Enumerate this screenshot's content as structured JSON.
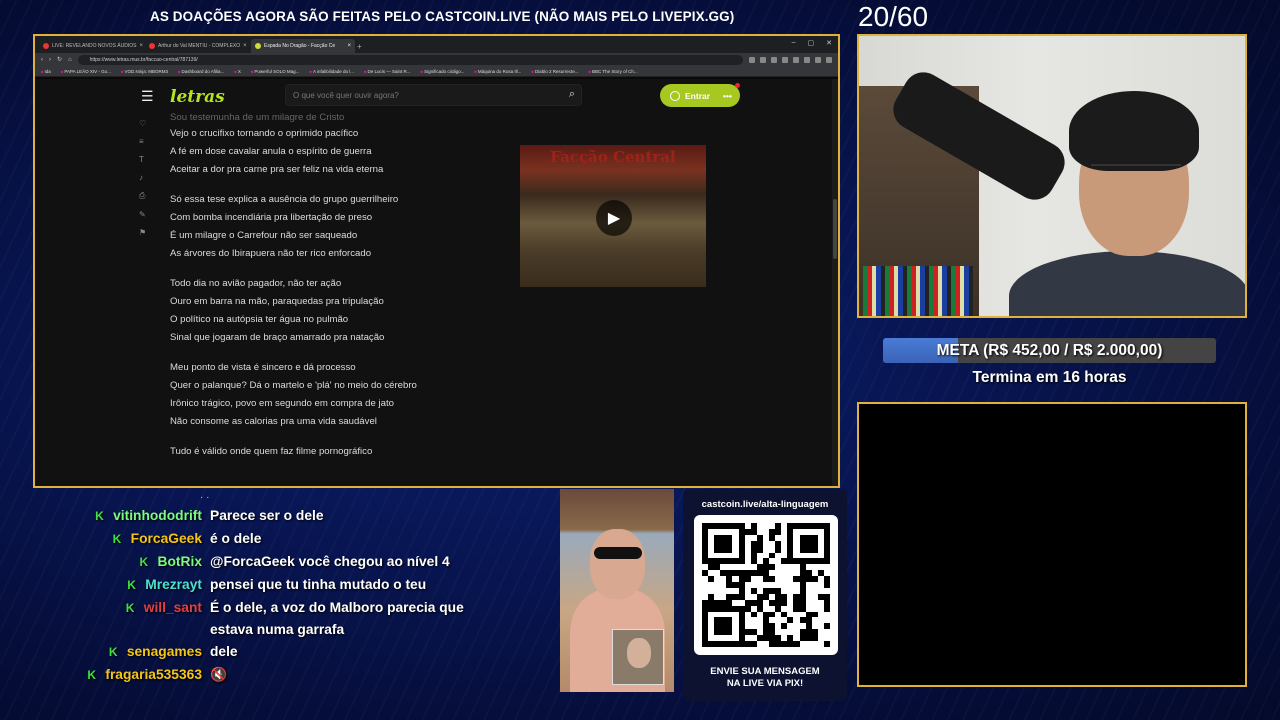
{
  "banner": "AS DOAÇÕES AGORA SÃO FEITAS PELO CASTCOIN.LIVE (NÃO MAIS PELO LIVEPIX.GG)",
  "counter": "20/60",
  "browser": {
    "tabs": [
      {
        "label": "LIVE: REVELANDO NOVOS ÁUDIOS"
      },
      {
        "label": "Arthur do Val MENTIU - COMPLEXO"
      },
      {
        "label": "Espada No Dragão - Facção Ce",
        "active": true
      }
    ],
    "url": "https://www.letras.mus.br/faccao-central/787139/",
    "bookmarks": [
      "Ida",
      "PAPA LEÃO XIV - Go...",
      "VOD.Ninja: MBORM3",
      "Dashboard do Afilia...",
      "X",
      "Powerful SOLO Mag...",
      "A infalibilidade do l...",
      "De Lucis — Saint R...",
      "Significado código...",
      "Máquina do Rosa Ill...",
      "Diablo 2 Resurrecte...",
      "BBC The Story of Ch..."
    ],
    "page": {
      "logo": "letras",
      "search_placeholder": "O que você quer ouvir agora?",
      "login_label": "Entrar",
      "lyrics_faded": "Sou testemunha de um milagre de Cristo",
      "stanzas": [
        [
          "Vejo o crucifixo tornando o oprimido pacífico",
          "A fé em dose cavalar anula o espírito de guerra",
          "Aceitar a dor pra carne pra ser feliz na vida eterna"
        ],
        [
          "Só essa tese explica a ausência do grupo guerrilheiro",
          "Com bomba incendiária pra libertação de preso",
          "É um milagre o Carrefour não ser saqueado",
          "As árvores do Ibirapuera não ter rico enforcado"
        ],
        [
          "Todo dia no avião pagador, não ter ação",
          "Ouro em barra na mão, paraquedas pra tripulação",
          "O político na autópsia ter água no pulmão",
          "Sinal que jogaram de braço amarrado pra natação"
        ],
        [
          "Meu ponto de vista é sincero e dá processo",
          "Quer o palanque? Dá o martelo e 'plá' no meio do cérebro",
          "Irônico trágico, povo em segundo em compra de jato",
          "Não consome as calorias pra uma vida saudável"
        ],
        [
          "Tudo é válido onde quem faz filme pornográfico"
        ]
      ],
      "video_title": "Facção Central"
    }
  },
  "goal": {
    "label": "META (R$ 452,00 / R$ 2.000,00)",
    "progress": 0.226,
    "ends": "Termina em 16 horas"
  },
  "chat": [
    {
      "user": "vitinhododrift",
      "color": "#7cfc7c",
      "text": "Parece ser o dele"
    },
    {
      "user": "ForcaGeek",
      "color": "#f5c518",
      "text": "é o dele"
    },
    {
      "user": "BotRix",
      "color": "#7cfc7c",
      "text": "@ForcaGeek você chegou ao nível 4"
    },
    {
      "user": "Mrezrayt",
      "color": "#4de0d0",
      "text": "pensei que tu tinha mutado o teu"
    },
    {
      "user": "will_sant",
      "color": "#e04040",
      "text": "É o dele, a voz do Malboro parecia que estava numa garrafa"
    },
    {
      "user": "senagames",
      "color": "#f5c518",
      "text": "dele"
    },
    {
      "user": "fragaria535363",
      "color": "#f5c518",
      "text": "🔇"
    }
  ],
  "qr": {
    "url": "castcoin.live/alta-linguagem",
    "caption_1": "ENVIE SUA MENSAGEM",
    "caption_2": "NA LIVE VIA PIX!"
  }
}
